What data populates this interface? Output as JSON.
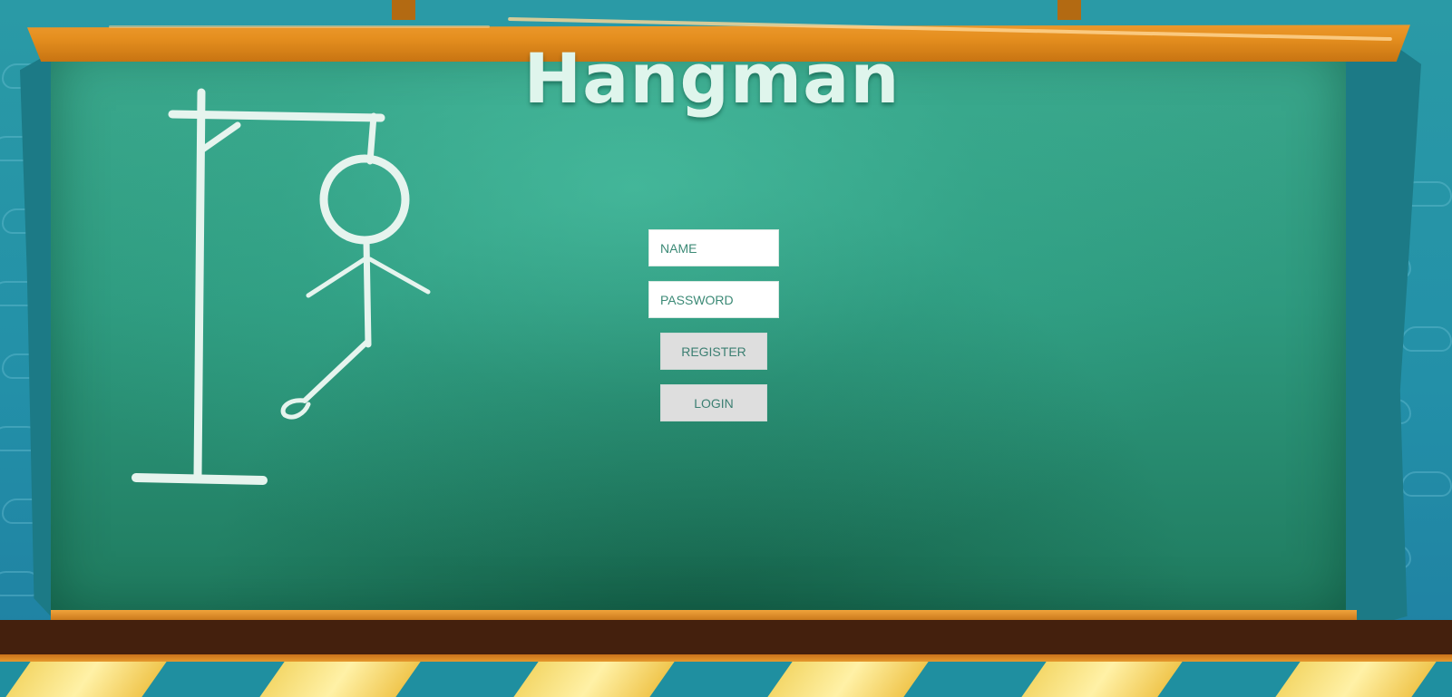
{
  "app": {
    "title": "Hangman"
  },
  "login_form": {
    "name_placeholder": "NAME",
    "password_placeholder": "PASSWORD",
    "register_label": "REGISTER",
    "login_label": "LOGIN"
  },
  "illustration": {
    "icon": "hangman-gallows-icon"
  },
  "colors": {
    "chalkboard": "#2e9a7f",
    "frame": "#e58f1f",
    "wall": "#2390a8",
    "title": "#dff5ec",
    "button": "#dedede"
  }
}
